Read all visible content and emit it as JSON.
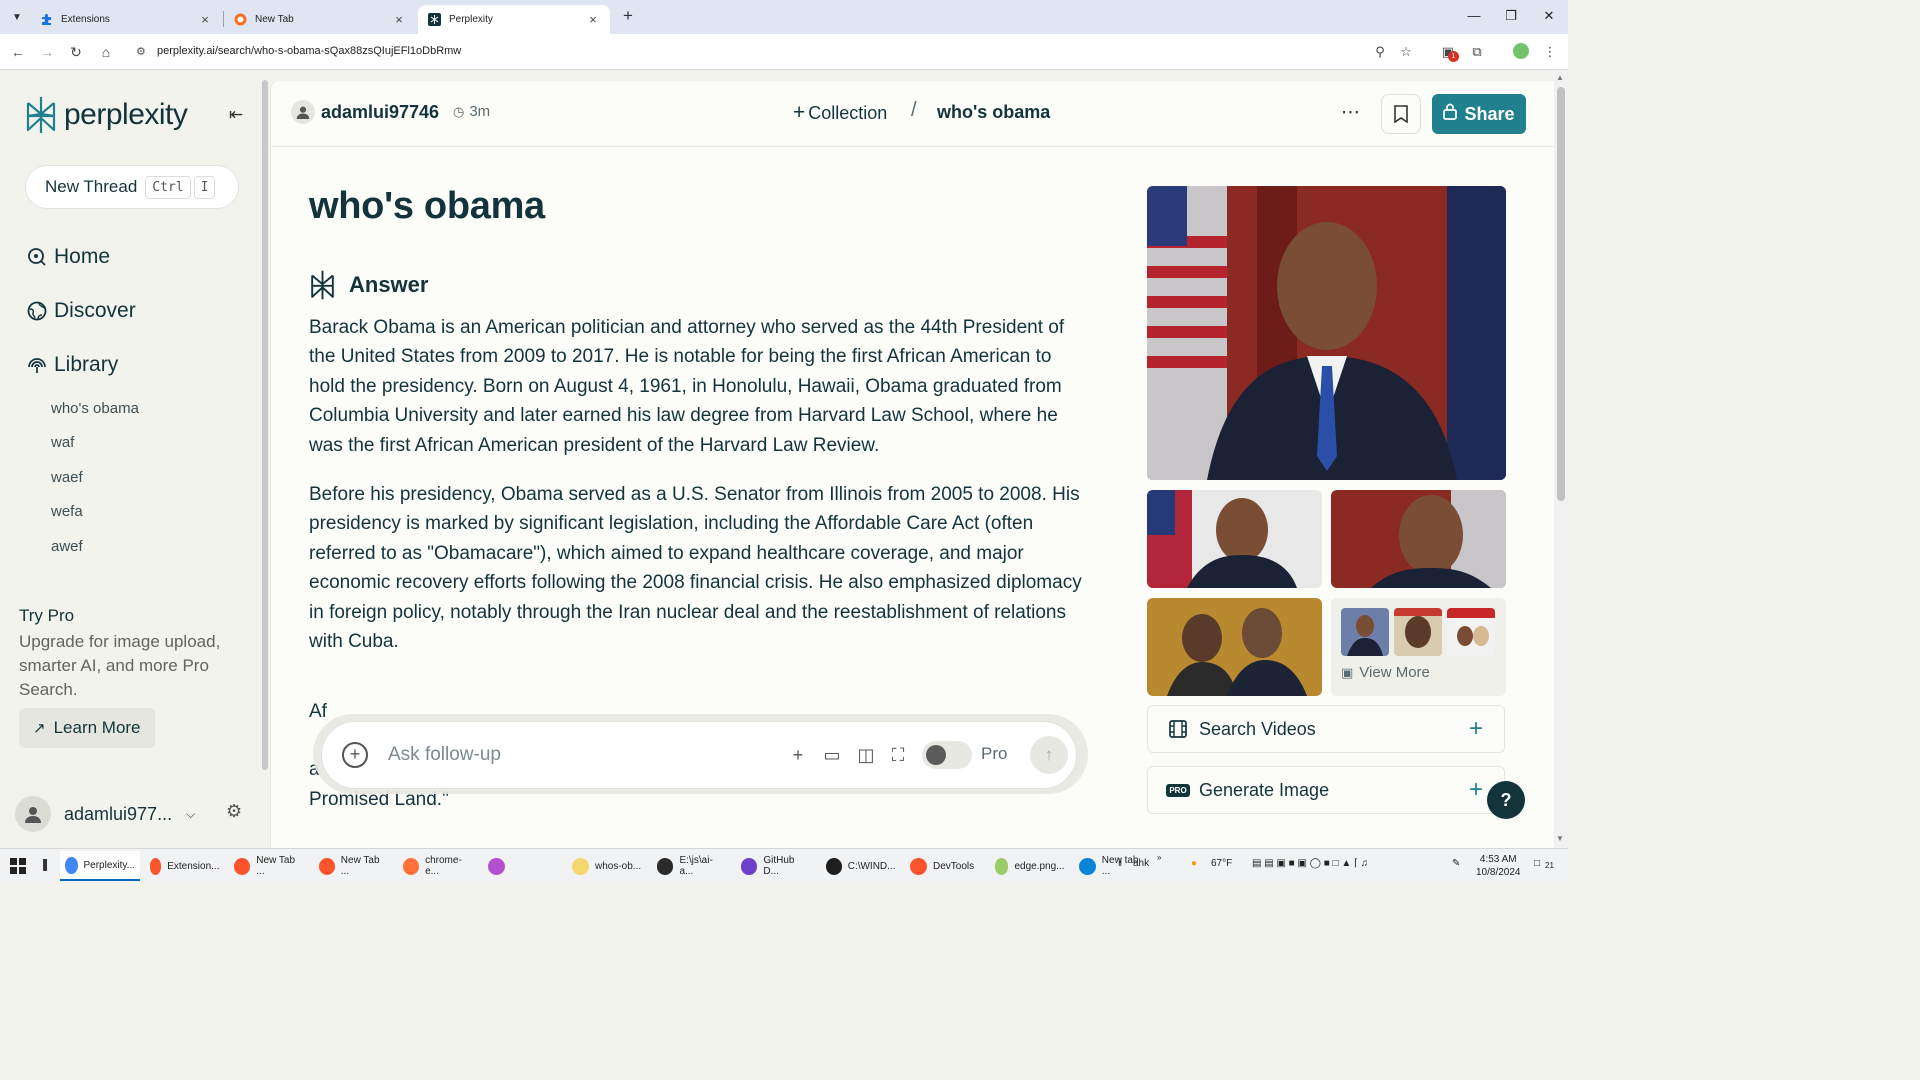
{
  "browser": {
    "tabs": [
      {
        "title": "Extensions",
        "icon": "puzzle-icon",
        "active": false
      },
      {
        "title": "New Tab",
        "icon": "browser-icon",
        "active": false
      },
      {
        "title": "Perplexity",
        "icon": "perplexity-icon",
        "active": true
      }
    ],
    "url": "perplexity.ai/search/who-s-obama-sQax88zsQIujEFl1oDbRmw",
    "extension_badge": "1"
  },
  "sidebar": {
    "brand": "perplexity",
    "new_thread": {
      "label": "New Thread",
      "shortcut": [
        "Ctrl",
        "I"
      ]
    },
    "nav": [
      {
        "label": "Home",
        "icon": "home-search-icon"
      },
      {
        "label": "Discover",
        "icon": "globe-icon"
      },
      {
        "label": "Library",
        "icon": "library-icon"
      }
    ],
    "library": [
      "who's obama",
      "waf",
      "waef",
      "wefa",
      "awef"
    ],
    "try_pro": {
      "title": "Try Pro",
      "description": "Upgrade for image upload, smarter AI, and more Pro Search.",
      "button": "Learn More"
    },
    "user": {
      "name": "adamlui977..."
    }
  },
  "topbar": {
    "user": "adamlui97746",
    "time": "3m",
    "collection": "Collection",
    "thread_title": "who's obama",
    "share": "Share"
  },
  "thread": {
    "query": "who's obama",
    "answer_label": "Answer",
    "paragraphs": [
      "Barack Obama is an American politician and attorney who served as the 44th President of the United States from 2009 to 2017. He is notable for being the first African American to hold the presidency. Born on August 4, 1961, in Honolulu, Hawaii, Obama graduated from Columbia University and later earned his law degree from Harvard Law School, where he was the first African American president of the Harvard Law Review.",
      "Before his presidency, Obama served as a U.S. Senator from Illinois from 2005 to 2008. His presidency is marked by significant legislation, including the Affordable Care Act (often referred to as \"Obamacare\"), which aimed to expand healthcare coverage, and major economic recovery efforts following the 2008 financial crisis. He also emphasized diplomacy in foreign policy, notably through the Iran nuclear deal and the reestablishment of relations with Cuba."
    ],
    "partial_line_start": "Af",
    "partial_line_a": "a",
    "partial_line_end": "Promised Land.\""
  },
  "followup": {
    "placeholder": "Ask follow-up",
    "pro_label": "Pro"
  },
  "media": {
    "view_more": "View More",
    "search_videos": "Search Videos",
    "generate_image": "Generate Image",
    "pro_chip": "PRO",
    "help": "?"
  },
  "taskbar": {
    "apps": [
      {
        "label": "Perplexity...",
        "color": "#4285f4",
        "active": true
      },
      {
        "label": "Extension...",
        "color": "#fb542b",
        "active": false
      },
      {
        "label": "New Tab ...",
        "color": "#fb542b",
        "active": false
      },
      {
        "label": "New Tab ...",
        "color": "#fb542b",
        "active": false
      },
      {
        "label": "chrome-e...",
        "color": "#ff7139",
        "active": false
      },
      {
        "label": "",
        "color": "#b44fd0",
        "active": false
      },
      {
        "label": "whos-ob...",
        "color": "#f5d76e",
        "active": false
      },
      {
        "label": "E:\\js\\ai-a...",
        "color": "#2b2b2b",
        "active": false
      },
      {
        "label": "GitHub D...",
        "color": "#6e40c9",
        "active": false
      },
      {
        "label": "C:\\WIND...",
        "color": "#1e1e1e",
        "active": false
      },
      {
        "label": "DevTools",
        "color": "#fb542b",
        "active": false
      },
      {
        "label": "edge.png...",
        "color": "#9ccc65",
        "active": false
      },
      {
        "label": "New tab ...",
        "color": "#0a84d6",
        "active": false
      }
    ],
    "ahk": "ahk",
    "weather": "67°F",
    "time": "4:53 AM",
    "date": "10/8/2024",
    "notifications": "21"
  },
  "colors": {
    "accent": "#20808d",
    "text": "#13343b",
    "sidebar_bg": "#f3f3ee",
    "main_bg": "#fcfcf9"
  }
}
